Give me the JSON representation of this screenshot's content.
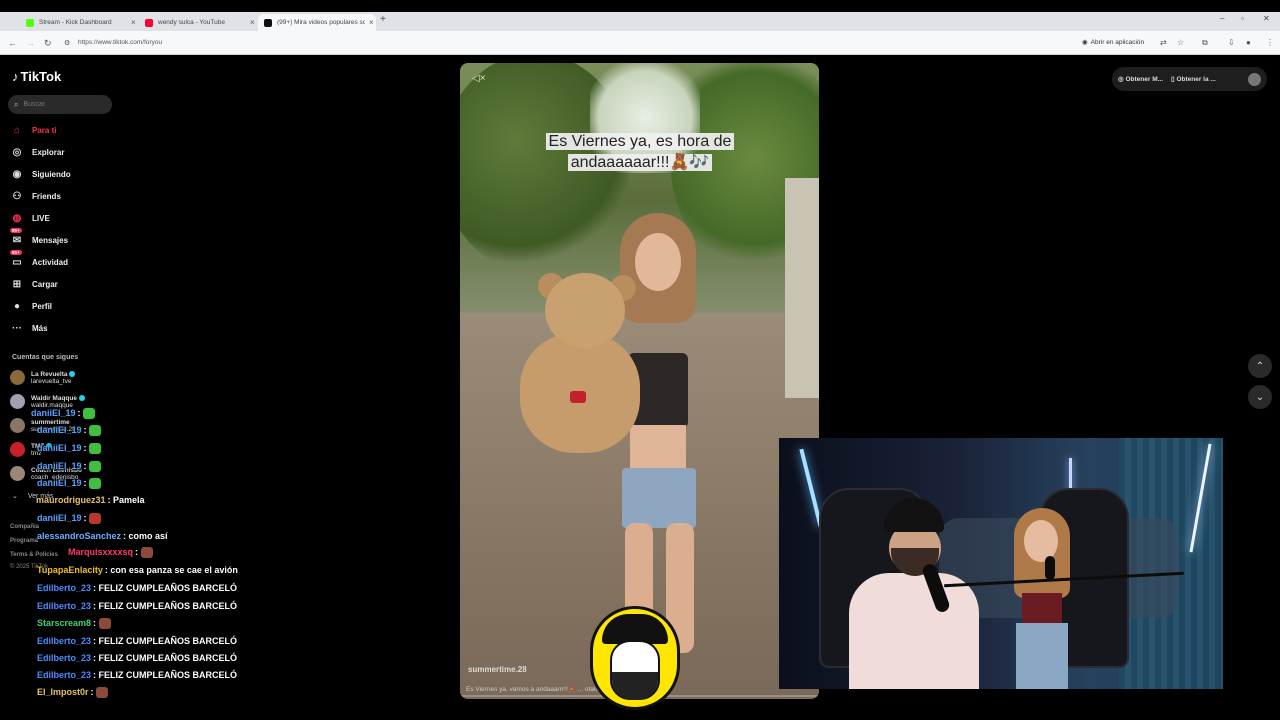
{
  "browser": {
    "tabs": [
      {
        "title": "Stream - Kick Dashboard",
        "color": "#53fc18",
        "active": false
      },
      {
        "title": "wendy sulca - YouTube",
        "color": "#ff0033",
        "active": false
      },
      {
        "title": "(99+) Mira videos populares sobre",
        "color": "#111111",
        "active": true
      }
    ],
    "url": "https://www.tiktok.com/foryou",
    "open_in_app": "Abrir en aplicación"
  },
  "tiktok": {
    "logo": "TikTok",
    "search_placeholder": "Buscar",
    "nav": [
      {
        "label": "Para ti",
        "icon": "home-icon",
        "active": true
      },
      {
        "label": "Explorar",
        "icon": "compass-icon"
      },
      {
        "label": "Siguiendo",
        "icon": "following-icon"
      },
      {
        "label": "Friends",
        "icon": "friends-icon"
      },
      {
        "label": "LIVE",
        "icon": "live-icon"
      },
      {
        "label": "Mensajes",
        "icon": "messages-icon",
        "badge": "99+"
      },
      {
        "label": "Actividad",
        "icon": "activity-icon",
        "badge": "99+"
      },
      {
        "label": "Cargar",
        "icon": "upload-icon"
      },
      {
        "label": "Perfil",
        "icon": "profile-icon"
      },
      {
        "label": "Más",
        "icon": "more-icon"
      }
    ],
    "following_header": "Cuentas que sigues",
    "following": [
      {
        "name": "La Revuelta",
        "handle": "larevuelta_tve"
      },
      {
        "name": "Waldir Maqque",
        "handle": "waldir.maqque"
      },
      {
        "name": "summertime",
        "handle": "summertime.28"
      },
      {
        "name": "TMZ",
        "handle": "tmz"
      },
      {
        "name": "Coach Edenisbo",
        "handle": "coach_edenisbo"
      }
    ],
    "see_more": "Ver más",
    "footer": [
      "Compañía",
      "Programa",
      "Terms & Policies",
      "© 2025 TikTok"
    ],
    "top_buttons": [
      "Obtener M...",
      "Obtener la ..."
    ]
  },
  "video": {
    "caption_line1": "Es Viernes ya, es hora de",
    "caption_line2": "andaaaaaar!!!🧸🎶",
    "username": "summertime.28",
    "description": "Es Viernes ya, vamos a andaaarrr!!🧸 ... otalos🧸 #panama #pt..."
  },
  "chat": [
    {
      "user": "daniiEl_19",
      "color": "#5aa0ff",
      "text": "",
      "emote": "green"
    },
    {
      "user": "daniiEl_19",
      "color": "#5aa0ff",
      "text": "",
      "emote": "green"
    },
    {
      "user": "daniiEl_19",
      "color": "#5aa0ff",
      "text": "",
      "emote": "green"
    },
    {
      "user": "daniiEl_19",
      "color": "#5aa0ff",
      "text": "",
      "emote": "green"
    },
    {
      "user": "daniiEl_19",
      "color": "#5aa0ff",
      "text": "",
      "emote": "green"
    },
    {
      "user": "maurodriguez31",
      "color": "#e5c16a",
      "text": "Pamela",
      "emote": ""
    },
    {
      "user": "daniiEl_19",
      "color": "#5aa0ff",
      "text": "",
      "emote": "red"
    },
    {
      "user": "alessandroSanchez",
      "color": "#6ab0ff",
      "text": "como así",
      "emote": ""
    },
    {
      "user": "Marquisxxxxsq",
      "color": "#ff3a6a",
      "text": "",
      "emote": "brown"
    },
    {
      "user": "TupapaEnlacity",
      "color": "#f0c020",
      "text": "con esa panza se cae el avión",
      "emote": ""
    },
    {
      "user": "Edilberto_23",
      "color": "#4a8cff",
      "text": "FELIZ CUMPLEAÑOS BARCELÓ",
      "emote": ""
    },
    {
      "user": "Edilberto_23",
      "color": "#4a8cff",
      "text": "FELIZ CUMPLEAÑOS BARCELÓ",
      "emote": ""
    },
    {
      "user": "Starscream8",
      "color": "#3fd07a",
      "text": "",
      "emote": "brown"
    },
    {
      "user": "Edilberto_23",
      "color": "#4a8cff",
      "text": "FELIZ CUMPLEAÑOS BARCELÓ",
      "emote": ""
    },
    {
      "user": "Edilberto_23",
      "color": "#4a8cff",
      "text": "FELIZ CUMPLEAÑOS BARCELÓ",
      "emote": ""
    },
    {
      "user": "Edilberto_23",
      "color": "#4a8cff",
      "text": "FELIZ CUMPLEAÑOS BARCELÓ",
      "emote": ""
    },
    {
      "user": "El_Impost0r",
      "color": "#e5c16a",
      "text": "",
      "emote": "brown"
    }
  ],
  "colors": {
    "tiktok_red": "#fe2c55",
    "bg": "#000000"
  }
}
